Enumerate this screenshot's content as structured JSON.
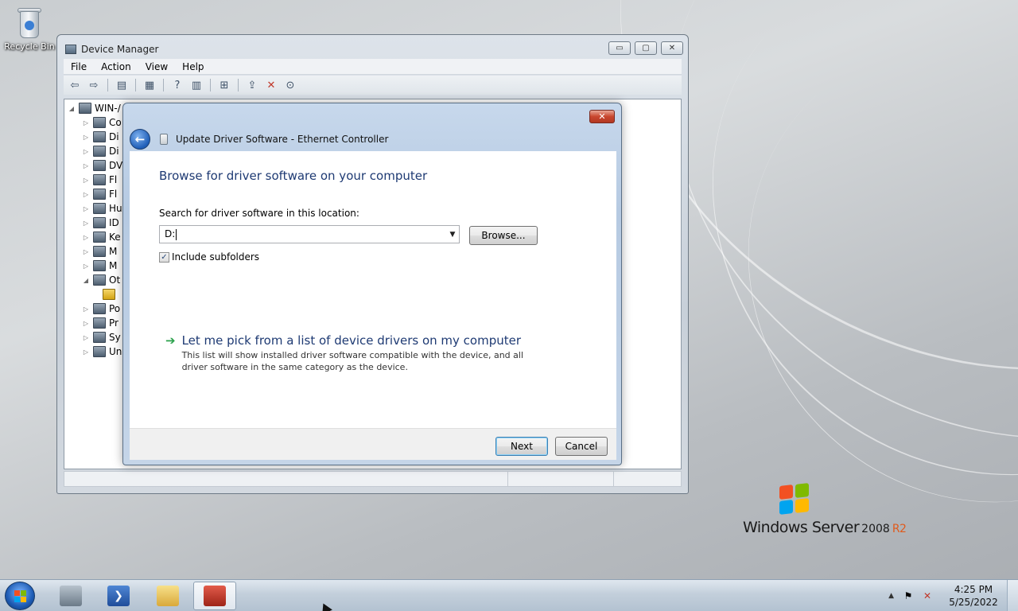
{
  "desktop": {
    "recycle_bin_label": "Recycle Bin",
    "brand": {
      "name": "Windows Server",
      "version": "2008",
      "edition": "R2"
    }
  },
  "device_manager": {
    "title": "Device Manager",
    "caption_buttons": {
      "minimize": "▭",
      "maximize": "▢",
      "close": "✕"
    },
    "menu": [
      "File",
      "Action",
      "View",
      "Help"
    ],
    "tree": [
      {
        "label": "WIN-/",
        "expander": "◢",
        "level": 0
      },
      {
        "label": "Co",
        "expander": "▷",
        "level": 1
      },
      {
        "label": "Di",
        "expander": "▷",
        "level": 1
      },
      {
        "label": "Di",
        "expander": "▷",
        "level": 1
      },
      {
        "label": "DV",
        "expander": "▷",
        "level": 1
      },
      {
        "label": "Fl",
        "expander": "▷",
        "level": 1
      },
      {
        "label": "Fl",
        "expander": "▷",
        "level": 1
      },
      {
        "label": "Hu",
        "expander": "▷",
        "level": 1
      },
      {
        "label": "ID",
        "expander": "▷",
        "level": 1
      },
      {
        "label": "Ke",
        "expander": "▷",
        "level": 1
      },
      {
        "label": "M",
        "expander": "▷",
        "level": 1
      },
      {
        "label": "M",
        "expander": "▷",
        "level": 1
      },
      {
        "label": "Ot",
        "expander": "◢",
        "level": 1
      },
      {
        "label": "",
        "expander": "",
        "level": 2
      },
      {
        "label": "Po",
        "expander": "▷",
        "level": 1
      },
      {
        "label": "Pr",
        "expander": "▷",
        "level": 1
      },
      {
        "label": "Sy",
        "expander": "▷",
        "level": 1
      },
      {
        "label": "Un",
        "expander": "▷",
        "level": 1
      }
    ]
  },
  "dialog": {
    "close_label": "✕",
    "title": "Update Driver Software - Ethernet Controller",
    "heading": "Browse for driver software on your computer",
    "search_label": "Search for driver software in this location:",
    "location_value": "D:",
    "browse_label": "Browse...",
    "include_subfolders_label": "Include subfolders",
    "include_subfolders_checked": "✓",
    "pick_title": "Let me pick from a list of device drivers on my computer",
    "pick_description": "This list will show installed driver software compatible with the device, and all driver software in the same category as the device.",
    "next_label": "Next",
    "cancel_label": "Cancel"
  },
  "taskbar": {
    "pinned": [
      {
        "name": "server-manager-icon",
        "color": "#7c8a97"
      },
      {
        "name": "powershell-icon",
        "color": "#2c5aa0"
      },
      {
        "name": "explorer-icon",
        "color": "#e8c35a"
      },
      {
        "name": "toolbox-icon",
        "color": "#c0392b"
      }
    ],
    "clock_time": "4:25 PM",
    "clock_date": "5/25/2022"
  }
}
